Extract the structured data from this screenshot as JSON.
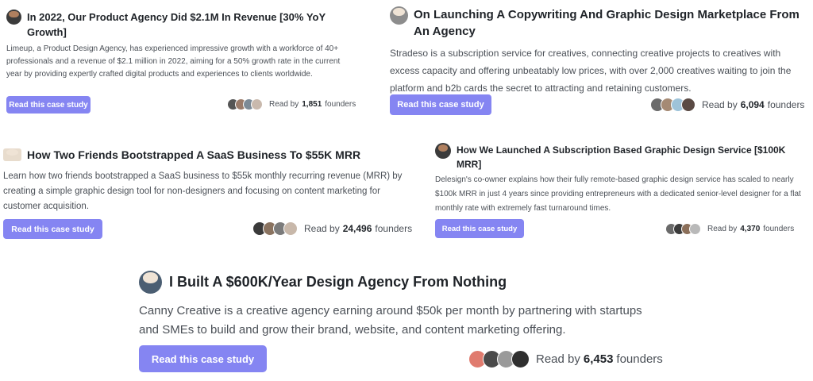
{
  "cards": [
    {
      "title": "In 2022, Our Product Agency Did $2.1M In Revenue [30% YoY Growth]",
      "description": "Limeup, a Product Design Agency, has experienced impressive growth with a workforce of 40+ professionals and a revenue of $2.1 million in 2022, aiming for a 50% growth rate in the current year by providing expertly crafted digital products and experiences to clients worldwide.",
      "button": "Read this case study",
      "readers_prefix": "Read by",
      "readers_count": "1,851",
      "readers_suffix": "founders"
    },
    {
      "title": "On Launching A Copywriting And Graphic Design Marketplace From An Agency",
      "description": "Stradeso is a subscription service for creatives, connecting creative projects to creatives with excess capacity and offering unbeatably low prices, with over 2,000 creatives waiting to join the platform and b2b cards the secret to attracting and retaining customers.",
      "button": "Read this case study",
      "readers_prefix": "Read by",
      "readers_count": "6,094",
      "readers_suffix": "founders"
    },
    {
      "title": "How Two Friends Bootstrapped A SaaS Business To $55K MRR",
      "description": "Learn how two friends bootstrapped a SaaS business to $55k monthly recurring revenue (MRR) by creating a simple graphic design tool for non-designers and focusing on content marketing for customer acquisition.",
      "button": "Read this case study",
      "readers_prefix": "Read by",
      "readers_count": "24,496",
      "readers_suffix": "founders"
    },
    {
      "title": "How We Launched A Subscription Based Graphic Design Service [$100K MRR]",
      "description": "Delesign's co-owner explains how their fully remote-based graphic design service has scaled to nearly $100k MRR in just 4 years since providing entrepreneurs with a dedicated senior-level designer for a flat monthly rate with extremely fast turnaround times.",
      "button": "Read this case study",
      "readers_prefix": "Read by",
      "readers_count": "4,370",
      "readers_suffix": "founders"
    },
    {
      "title": "I Built A $600K/Year Design Agency From Nothing",
      "description": "Canny Creative is a creative agency earning around $50k per month by partnering with startups and SMEs to build and grow their brand, website, and content marketing offering.",
      "button": "Read this case study",
      "readers_prefix": "Read by",
      "readers_count": "6,453",
      "readers_suffix": "founders"
    }
  ],
  "colors": {
    "button_bg": "#8585f2",
    "button_text": "#ffffff",
    "title": "#1f2328",
    "body": "#4b5057"
  }
}
